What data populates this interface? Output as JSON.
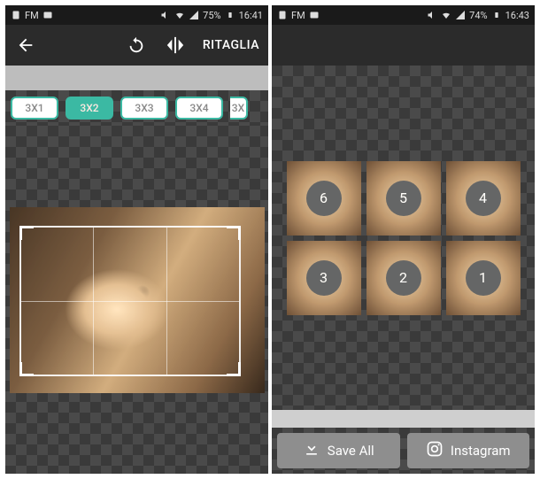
{
  "left": {
    "status": {
      "fm_label": "FM",
      "battery_pct": "75%",
      "time": "16:41"
    },
    "toolbar": {
      "crop_label": "RITAGLIA"
    },
    "grid_options": [
      {
        "label": "3X1",
        "active": false
      },
      {
        "label": "3X2",
        "active": true
      },
      {
        "label": "3X3",
        "active": false
      },
      {
        "label": "3X4",
        "active": false
      },
      {
        "label": "3X",
        "active": false,
        "clipped": true
      }
    ]
  },
  "right": {
    "status": {
      "fm_label": "FM",
      "battery_pct": "74%",
      "time": "16:43"
    },
    "tiles": [
      {
        "number": "6"
      },
      {
        "number": "5"
      },
      {
        "number": "4"
      },
      {
        "number": "3"
      },
      {
        "number": "2"
      },
      {
        "number": "1"
      }
    ],
    "buttons": {
      "save_all": "Save All",
      "instagram": "Instagram"
    }
  }
}
